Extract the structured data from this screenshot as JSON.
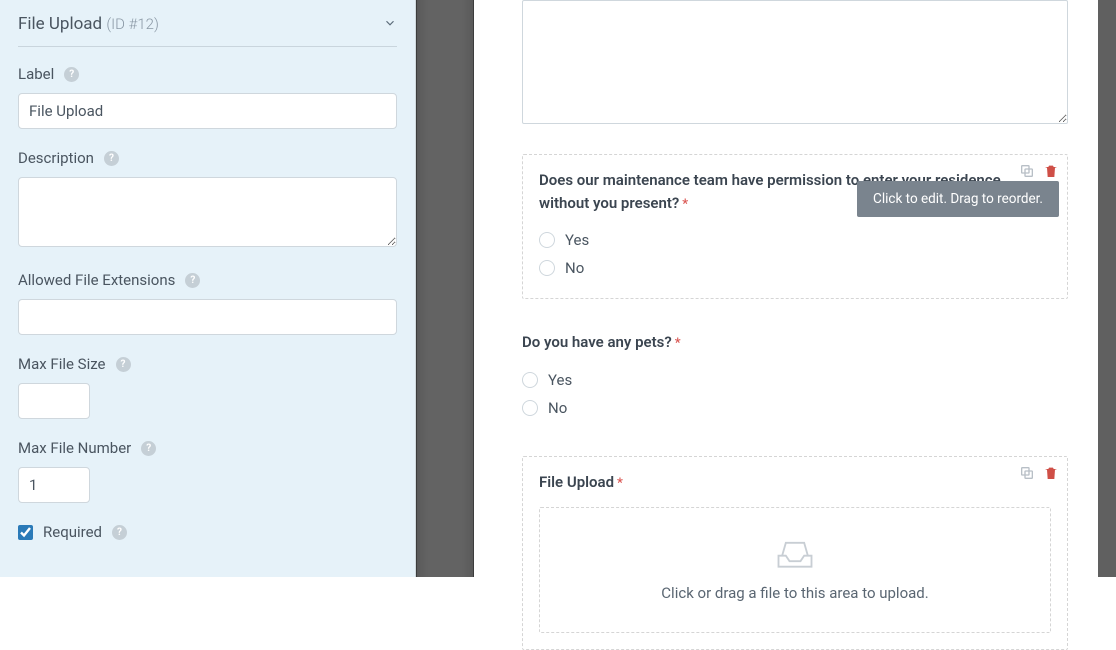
{
  "sidebar": {
    "title": "File Upload",
    "id_label": "(ID #12)",
    "fields": {
      "label": {
        "caption": "Label",
        "value": "File Upload"
      },
      "description": {
        "caption": "Description",
        "value": ""
      },
      "extensions": {
        "caption": "Allowed File Extensions",
        "value": ""
      },
      "max_size": {
        "caption": "Max File Size",
        "value": ""
      },
      "max_num": {
        "caption": "Max File Number",
        "value": "1"
      },
      "required": {
        "caption": "Required",
        "checked": true
      }
    }
  },
  "preview": {
    "block1": {
      "label": "Does our maintenance team have permission to enter your residence without you present?",
      "options": [
        "Yes",
        "No"
      ],
      "tooltip": "Click to edit. Drag to reorder."
    },
    "block2": {
      "label": "Do you have any pets?",
      "options": [
        "Yes",
        "No"
      ]
    },
    "block3": {
      "label": "File Upload",
      "upload_text": "Click or drag a file to this area to upload."
    }
  }
}
